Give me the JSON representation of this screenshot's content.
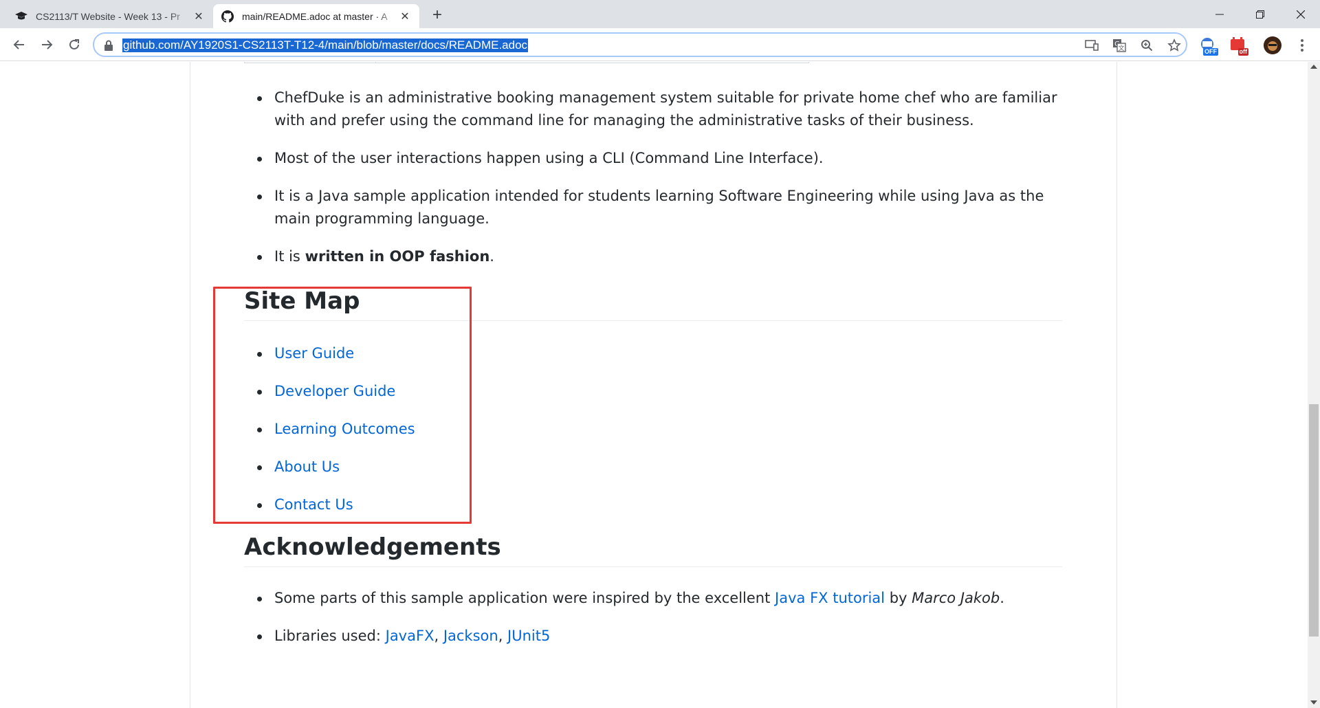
{
  "browser": {
    "tabs": [
      {
        "title": "CS2113/T Website - Week 13 - Pr",
        "icon": "graduation-cap-icon"
      },
      {
        "title": "main/README.adoc at master · A",
        "icon": "github-icon"
      }
    ],
    "url": "github.com/AY1920S1-CS2113T-T12-4/main/blob/master/docs/README.adoc",
    "extension_badges": [
      "OFF",
      "off"
    ]
  },
  "readme": {
    "intro_items": [
      "ChefDuke is an administrative booking management system suitable for private home chef who are familiar with and prefer using the command line for managing the administrative tasks of their business.",
      "Most of the user interactions happen using a CLI (Command Line Interface).",
      "It is a Java sample application intended for students learning Software Engineering while using Java as the main programming language."
    ],
    "oop_item": {
      "prefix": "It is ",
      "bold": "written in OOP fashion",
      "suffix": "."
    },
    "site_map": {
      "heading": "Site Map",
      "links": [
        "User Guide",
        "Developer Guide",
        "Learning Outcomes",
        "About Us",
        "Contact Us"
      ]
    },
    "acknowledgements": {
      "heading": "Acknowledgements",
      "item1": {
        "prefix": "Some parts of this sample application were inspired by the excellent ",
        "link": "Java FX tutorial",
        "middle": " by ",
        "author": "Marco Jakob",
        "suffix": "."
      },
      "item2": {
        "prefix": "Libraries used: ",
        "libs": [
          "JavaFX",
          "Jackson",
          "JUnit5"
        ],
        "sep": ", "
      }
    }
  },
  "colors": {
    "link": "#0366d6",
    "highlight": "#e53935",
    "url_selection": "#1967d2"
  }
}
